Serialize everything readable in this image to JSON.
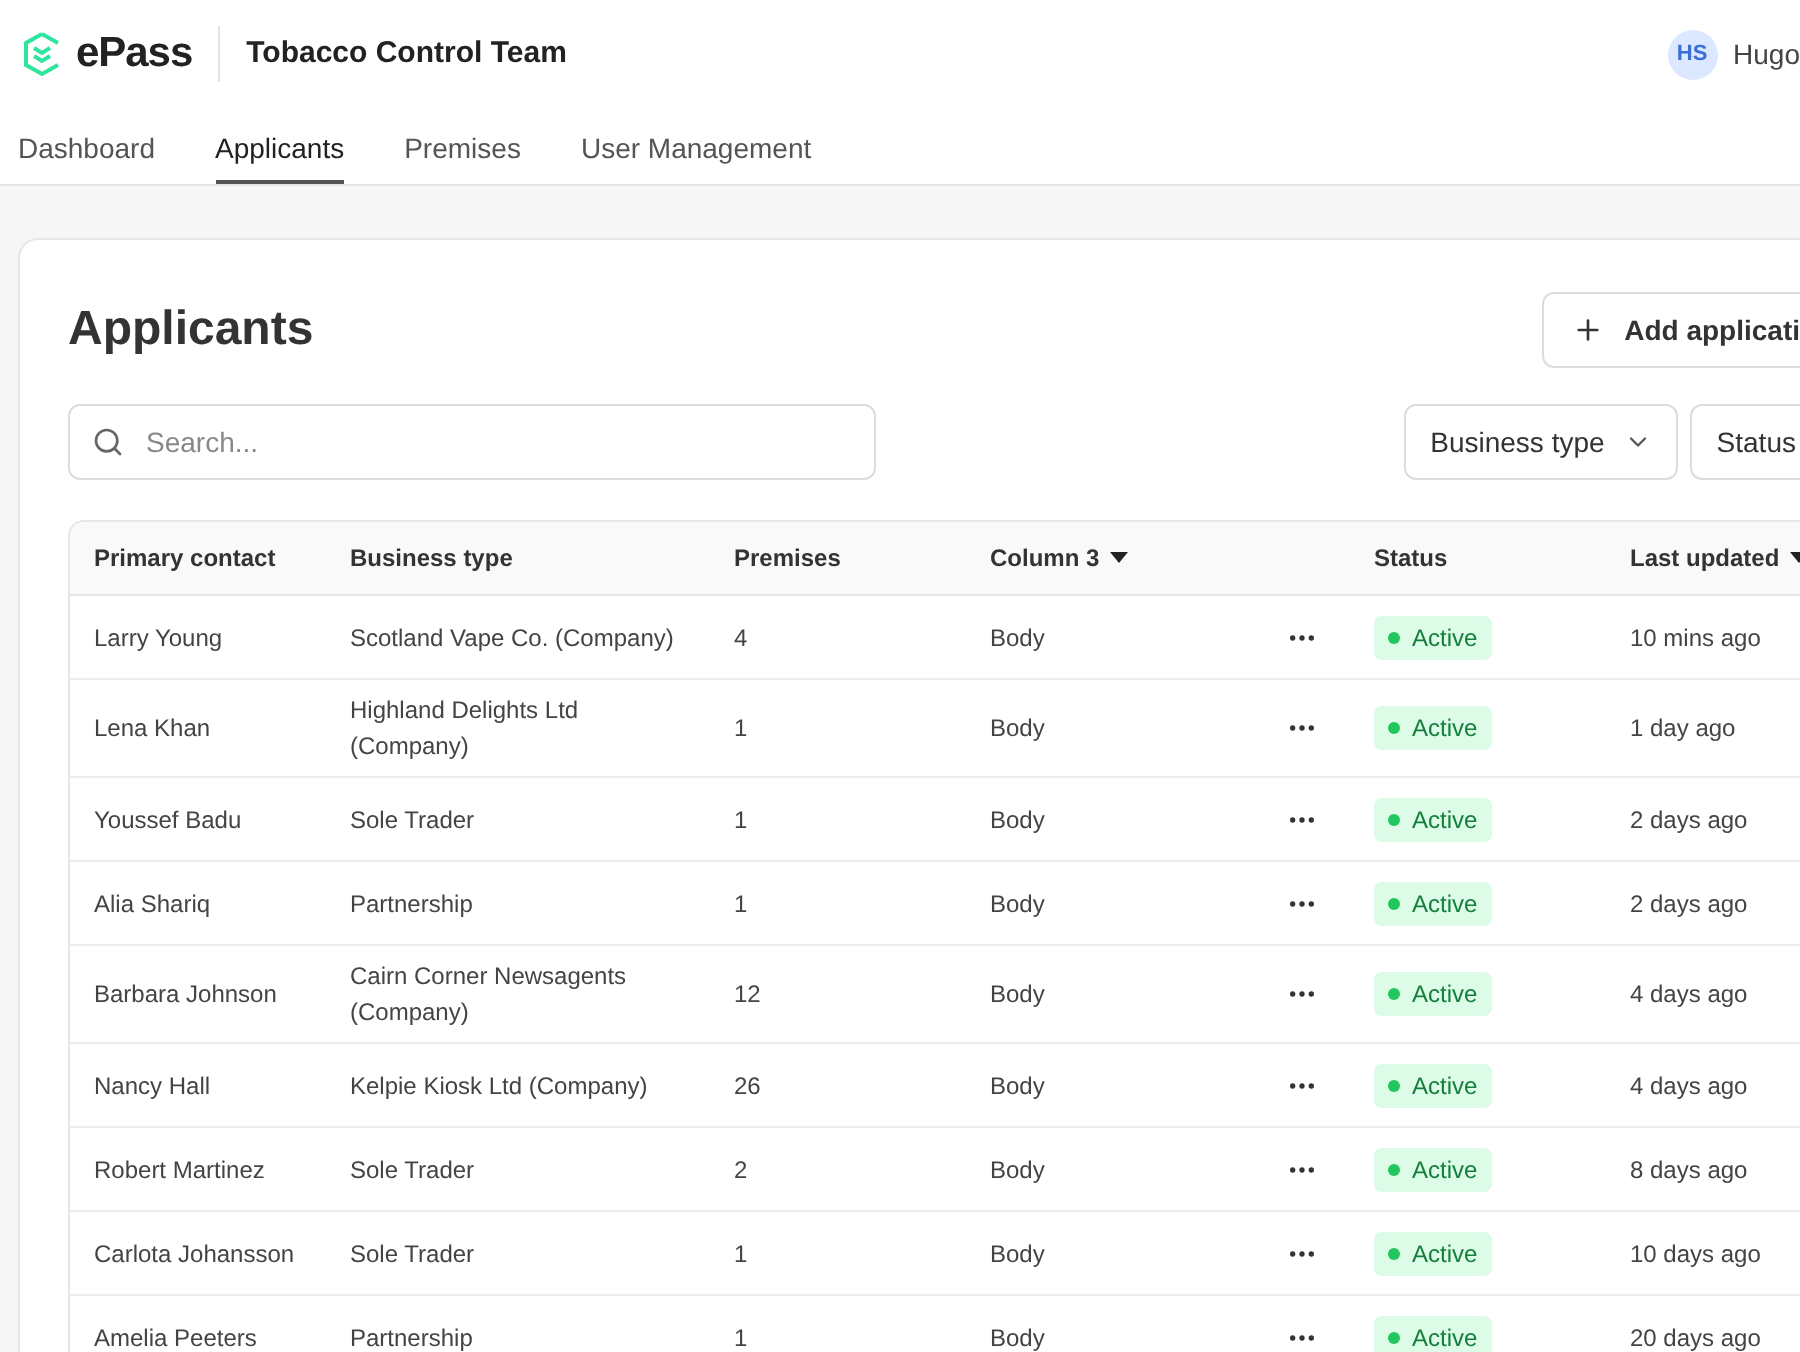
{
  "header": {
    "brand": "ePass",
    "team": "Tobacco Control Team",
    "user": {
      "initials": "HS",
      "name": "Hugo"
    }
  },
  "nav": [
    {
      "label": "Dashboard",
      "selected": false
    },
    {
      "label": "Applicants",
      "selected": true
    },
    {
      "label": "Premises",
      "selected": false
    },
    {
      "label": "User Management",
      "selected": false
    }
  ],
  "page": {
    "title": "Applicants",
    "add_button": "Add applicati",
    "search": {
      "placeholder": "Search..."
    },
    "filters": [
      {
        "label": "Business type",
        "dropdown": true
      },
      {
        "label": "Status",
        "dropdown": false
      }
    ]
  },
  "table": {
    "columns": [
      {
        "label": "Primary contact",
        "sortable": false
      },
      {
        "label": "Business type",
        "sortable": false
      },
      {
        "label": "Premises",
        "sortable": false
      },
      {
        "label": "Column 3",
        "sortable": true
      },
      {
        "label": "Status",
        "sortable": false
      },
      {
        "label": "Last updated",
        "sortable": true
      }
    ],
    "rows": [
      {
        "contact": "Larry Young",
        "business": "Scotland Vape Co. (Company)",
        "premises": "4",
        "column_3": "Body",
        "status": "Active",
        "updated": "10 mins ago"
      },
      {
        "contact": "Lena Khan",
        "business": "Highland Delights Ltd (Company)",
        "premises": "1",
        "column_3": "Body",
        "status": "Active",
        "updated": "1 day ago"
      },
      {
        "contact": "Youssef Badu",
        "business": "Sole Trader",
        "premises": "1",
        "column_3": "Body",
        "status": "Active",
        "updated": "2 days ago"
      },
      {
        "contact": "Alia Shariq",
        "business": "Partnership",
        "premises": "1",
        "column_3": "Body",
        "status": "Active",
        "updated": "2 days ago"
      },
      {
        "contact": "Barbara Johnson",
        "business": "Cairn Corner Newsagents (Company)",
        "premises": "12",
        "column_3": "Body",
        "status": "Active",
        "updated": "4 days ago"
      },
      {
        "contact": "Nancy Hall",
        "business": "Kelpie Kiosk Ltd (Company)",
        "premises": "26",
        "column_3": "Body",
        "status": "Active",
        "updated": "4 days ago"
      },
      {
        "contact": "Robert Martinez",
        "business": "Sole Trader",
        "premises": "2",
        "column_3": "Body",
        "status": "Active",
        "updated": "8 days ago"
      },
      {
        "contact": "Carlota Johansson",
        "business": "Sole Trader",
        "premises": "1",
        "column_3": "Body",
        "status": "Active",
        "updated": "10 days ago"
      },
      {
        "contact": "Amelia Peeters",
        "business": "Partnership",
        "premises": "1",
        "column_3": "Body",
        "status": "Active",
        "updated": "20 days ago"
      }
    ]
  }
}
